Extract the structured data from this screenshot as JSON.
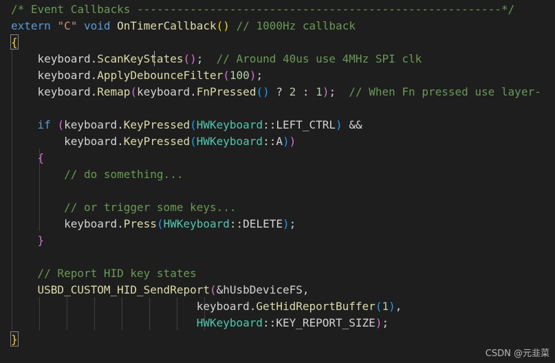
{
  "editor": {
    "language": "cpp",
    "theme_colors": {
      "background": "#1e1e1e",
      "comment": "#6a9955",
      "keyword": "#569cd6",
      "string": "#ce9178",
      "function": "#dcdcaa",
      "number": "#b5cea8",
      "type": "#4ec9b0",
      "plain": "#d4d4d4",
      "bracket_level_1": "#ffd700",
      "bracket_level_2": "#da70d6",
      "bracket_level_3": "#179fff"
    },
    "lines": [
      {
        "tokens": [
          {
            "t": "/* Event Callbacks -------------------------------------------------------*/",
            "c": "comment"
          }
        ]
      },
      {
        "tokens": [
          {
            "t": "extern",
            "c": "keyword"
          },
          {
            "t": " ",
            "c": "plain"
          },
          {
            "t": "\"C\"",
            "c": "string"
          },
          {
            "t": " ",
            "c": "plain"
          },
          {
            "t": "void",
            "c": "keyword"
          },
          {
            "t": " ",
            "c": "plain"
          },
          {
            "t": "OnTimerCallback",
            "c": "func"
          },
          {
            "t": "()",
            "c": "p1"
          },
          {
            "t": " ",
            "c": "plain"
          },
          {
            "t": "// 1000Hz callback",
            "c": "comment"
          }
        ]
      },
      {
        "tokens": [
          {
            "t": "{",
            "c": "p1"
          }
        ]
      },
      {
        "tokens": [
          {
            "t": "    keyboard.",
            "c": "plain"
          },
          {
            "t": "ScanKeyStates",
            "c": "func"
          },
          {
            "t": "()",
            "c": "p2"
          },
          {
            "t": ";  ",
            "c": "plain"
          },
          {
            "t": "// Around 40us use 4MHz SPI clk",
            "c": "comment"
          }
        ]
      },
      {
        "tokens": [
          {
            "t": "    keyboard.",
            "c": "plain"
          },
          {
            "t": "ApplyDebounceFilter",
            "c": "func"
          },
          {
            "t": "(",
            "c": "p2"
          },
          {
            "t": "100",
            "c": "number"
          },
          {
            "t": ")",
            "c": "p2"
          },
          {
            "t": ";",
            "c": "plain"
          }
        ]
      },
      {
        "tokens": [
          {
            "t": "    keyboard.",
            "c": "plain"
          },
          {
            "t": "Remap",
            "c": "func"
          },
          {
            "t": "(",
            "c": "p2"
          },
          {
            "t": "keyboard.",
            "c": "plain"
          },
          {
            "t": "FnPressed",
            "c": "func"
          },
          {
            "t": "()",
            "c": "p3"
          },
          {
            "t": " ? ",
            "c": "plain"
          },
          {
            "t": "2",
            "c": "number"
          },
          {
            "t": " : ",
            "c": "plain"
          },
          {
            "t": "1",
            "c": "number"
          },
          {
            "t": ")",
            "c": "p2"
          },
          {
            "t": ";  ",
            "c": "plain"
          },
          {
            "t": "// When Fn pressed use layer-",
            "c": "comment"
          }
        ]
      },
      {
        "tokens": []
      },
      {
        "tokens": [
          {
            "t": "    ",
            "c": "plain"
          },
          {
            "t": "if",
            "c": "keyword"
          },
          {
            "t": " ",
            "c": "plain"
          },
          {
            "t": "(",
            "c": "p2"
          },
          {
            "t": "keyboard.",
            "c": "plain"
          },
          {
            "t": "KeyPressed",
            "c": "func"
          },
          {
            "t": "(",
            "c": "p3"
          },
          {
            "t": "HWKeyboard",
            "c": "type"
          },
          {
            "t": "::LEFT_CTRL",
            "c": "plain"
          },
          {
            "t": ")",
            "c": "p3"
          },
          {
            "t": " &&",
            "c": "plain"
          }
        ]
      },
      {
        "tokens": [
          {
            "t": "        keyboard.",
            "c": "plain"
          },
          {
            "t": "KeyPressed",
            "c": "func"
          },
          {
            "t": "(",
            "c": "p3"
          },
          {
            "t": "HWKeyboard",
            "c": "type"
          },
          {
            "t": "::A",
            "c": "plain"
          },
          {
            "t": ")",
            "c": "p3"
          },
          {
            "t": ")",
            "c": "p2"
          }
        ]
      },
      {
        "tokens": [
          {
            "t": "    ",
            "c": "plain"
          },
          {
            "t": "{",
            "c": "p2"
          }
        ]
      },
      {
        "tokens": [
          {
            "t": "        ",
            "c": "plain"
          },
          {
            "t": "// do something...",
            "c": "comment"
          }
        ]
      },
      {
        "tokens": []
      },
      {
        "tokens": [
          {
            "t": "        ",
            "c": "plain"
          },
          {
            "t": "// or trigger some keys...",
            "c": "comment"
          }
        ]
      },
      {
        "tokens": [
          {
            "t": "        keyboard.",
            "c": "plain"
          },
          {
            "t": "Press",
            "c": "func"
          },
          {
            "t": "(",
            "c": "p3"
          },
          {
            "t": "HWKeyboard",
            "c": "type"
          },
          {
            "t": "::DELETE",
            "c": "plain"
          },
          {
            "t": ")",
            "c": "p3"
          },
          {
            "t": ";",
            "c": "plain"
          }
        ]
      },
      {
        "tokens": [
          {
            "t": "    ",
            "c": "plain"
          },
          {
            "t": "}",
            "c": "p2"
          }
        ]
      },
      {
        "tokens": []
      },
      {
        "tokens": [
          {
            "t": "    ",
            "c": "plain"
          },
          {
            "t": "// Report HID key states",
            "c": "comment"
          }
        ]
      },
      {
        "tokens": [
          {
            "t": "    ",
            "c": "plain"
          },
          {
            "t": "USBD_CUSTOM_HID_SendReport",
            "c": "func"
          },
          {
            "t": "(",
            "c": "p2"
          },
          {
            "t": "&hUsbDeviceFS,",
            "c": "plain"
          }
        ]
      },
      {
        "tokens": [
          {
            "t": "                            keyboard.",
            "c": "plain"
          },
          {
            "t": "GetHidReportBuffer",
            "c": "func"
          },
          {
            "t": "(",
            "c": "p3"
          },
          {
            "t": "1",
            "c": "number"
          },
          {
            "t": ")",
            "c": "p3"
          },
          {
            "t": ",",
            "c": "plain"
          }
        ]
      },
      {
        "tokens": [
          {
            "t": "                            ",
            "c": "plain"
          },
          {
            "t": "HWKeyboard",
            "c": "type"
          },
          {
            "t": "::KEY_REPORT_SIZE",
            "c": "plain"
          },
          {
            "t": ")",
            "c": "p2"
          },
          {
            "t": ";",
            "c": "plain"
          }
        ]
      },
      {
        "tokens": [
          {
            "t": "}",
            "c": "p1"
          }
        ]
      }
    ]
  },
  "watermark": "CSDN @元韭菜"
}
